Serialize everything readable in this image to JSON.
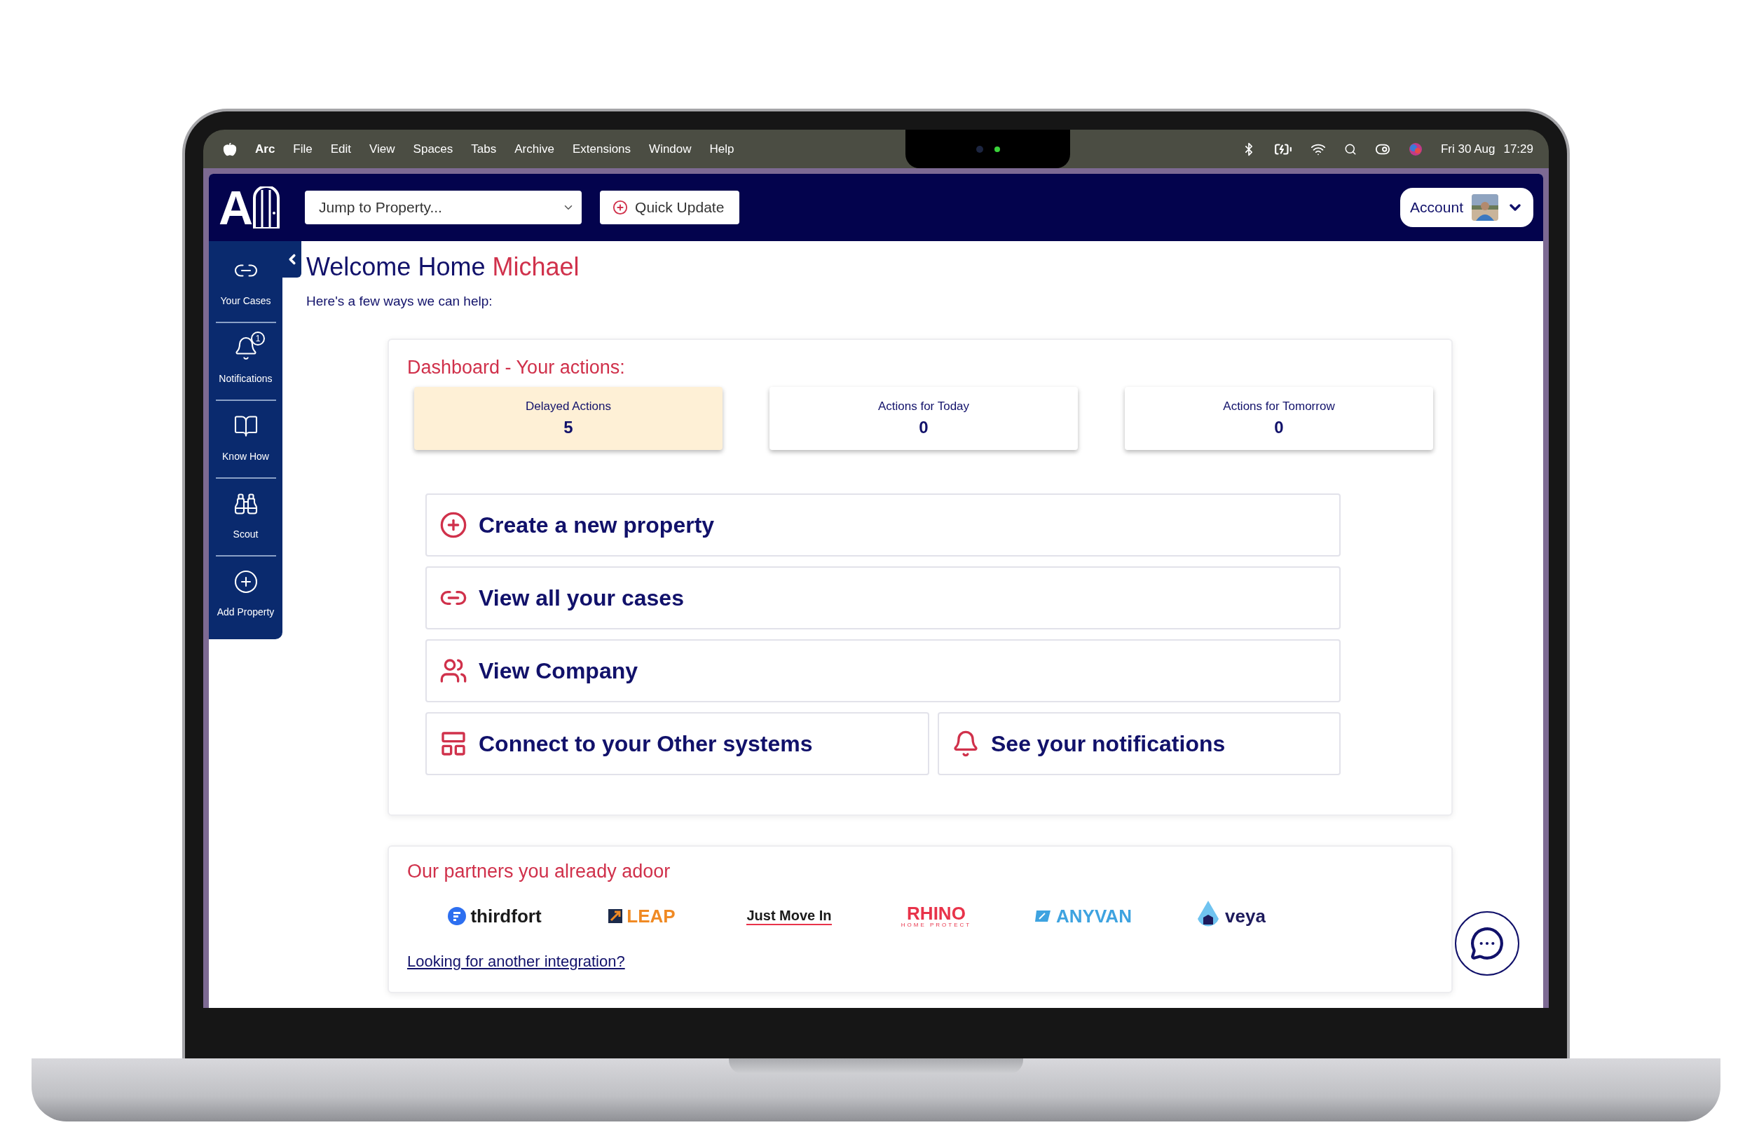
{
  "menu_bar": {
    "app_name": "Arc",
    "menus": [
      "File",
      "Edit",
      "View",
      "Spaces",
      "Tabs",
      "Archive",
      "Extensions",
      "Window",
      "Help"
    ],
    "date": "Fri 30 Aug",
    "time": "17:29"
  },
  "header": {
    "logo_text": "A",
    "property_select": {
      "placeholder": "Jump to Property..."
    },
    "quick_update": "Quick Update",
    "account": "Account"
  },
  "sidebar": {
    "items": [
      {
        "label": "Your Cases",
        "kind": "cases"
      },
      {
        "label": "Notifications",
        "kind": "notifications",
        "badge": "1"
      },
      {
        "label": "Know How",
        "kind": "knowhow"
      },
      {
        "label": "Scout",
        "kind": "scout"
      },
      {
        "label": "Add Property",
        "kind": "add"
      }
    ]
  },
  "welcome": {
    "greeting": "Welcome Home",
    "name": "Michael",
    "subtitle": "Here's a few ways we can help:"
  },
  "dashboard": {
    "title": "Dashboard - Your actions:",
    "stats": [
      {
        "label": "Delayed Actions",
        "value": "5",
        "highlighted": true
      },
      {
        "label": "Actions for Today",
        "value": "0",
        "highlighted": false
      },
      {
        "label": "Actions for Tomorrow",
        "value": "0",
        "highlighted": false
      }
    ],
    "actions": [
      [
        {
          "label": "Create a new property",
          "kind": "plus"
        }
      ],
      [
        {
          "label": "View all your cases",
          "kind": "link"
        }
      ],
      [
        {
          "label": "View Company",
          "kind": "people"
        }
      ],
      [
        {
          "label": "Connect to your Other systems",
          "kind": "systems"
        },
        {
          "label": "See your notifications",
          "kind": "bell"
        }
      ]
    ]
  },
  "partners": {
    "title": "Our partners you already adoor",
    "items": [
      {
        "name": "thirdfort",
        "kind": "dot",
        "color": "#1a1a1a"
      },
      {
        "name": "LEAP",
        "kind": "square",
        "color": "#f08a24"
      },
      {
        "name": "Just Move In",
        "kind": "underline",
        "color": "#1a1a1a"
      },
      {
        "name": "RHINO",
        "kind": "subtitle",
        "subtitle": "HOME PROTECT",
        "color": "#e8334a"
      },
      {
        "name": "ANYVAN",
        "kind": "van",
        "color": "#3ea3e0"
      },
      {
        "name": "veya",
        "kind": "drop",
        "color": "#1d1a5c"
      }
    ],
    "link": "Looking for another integration?"
  }
}
